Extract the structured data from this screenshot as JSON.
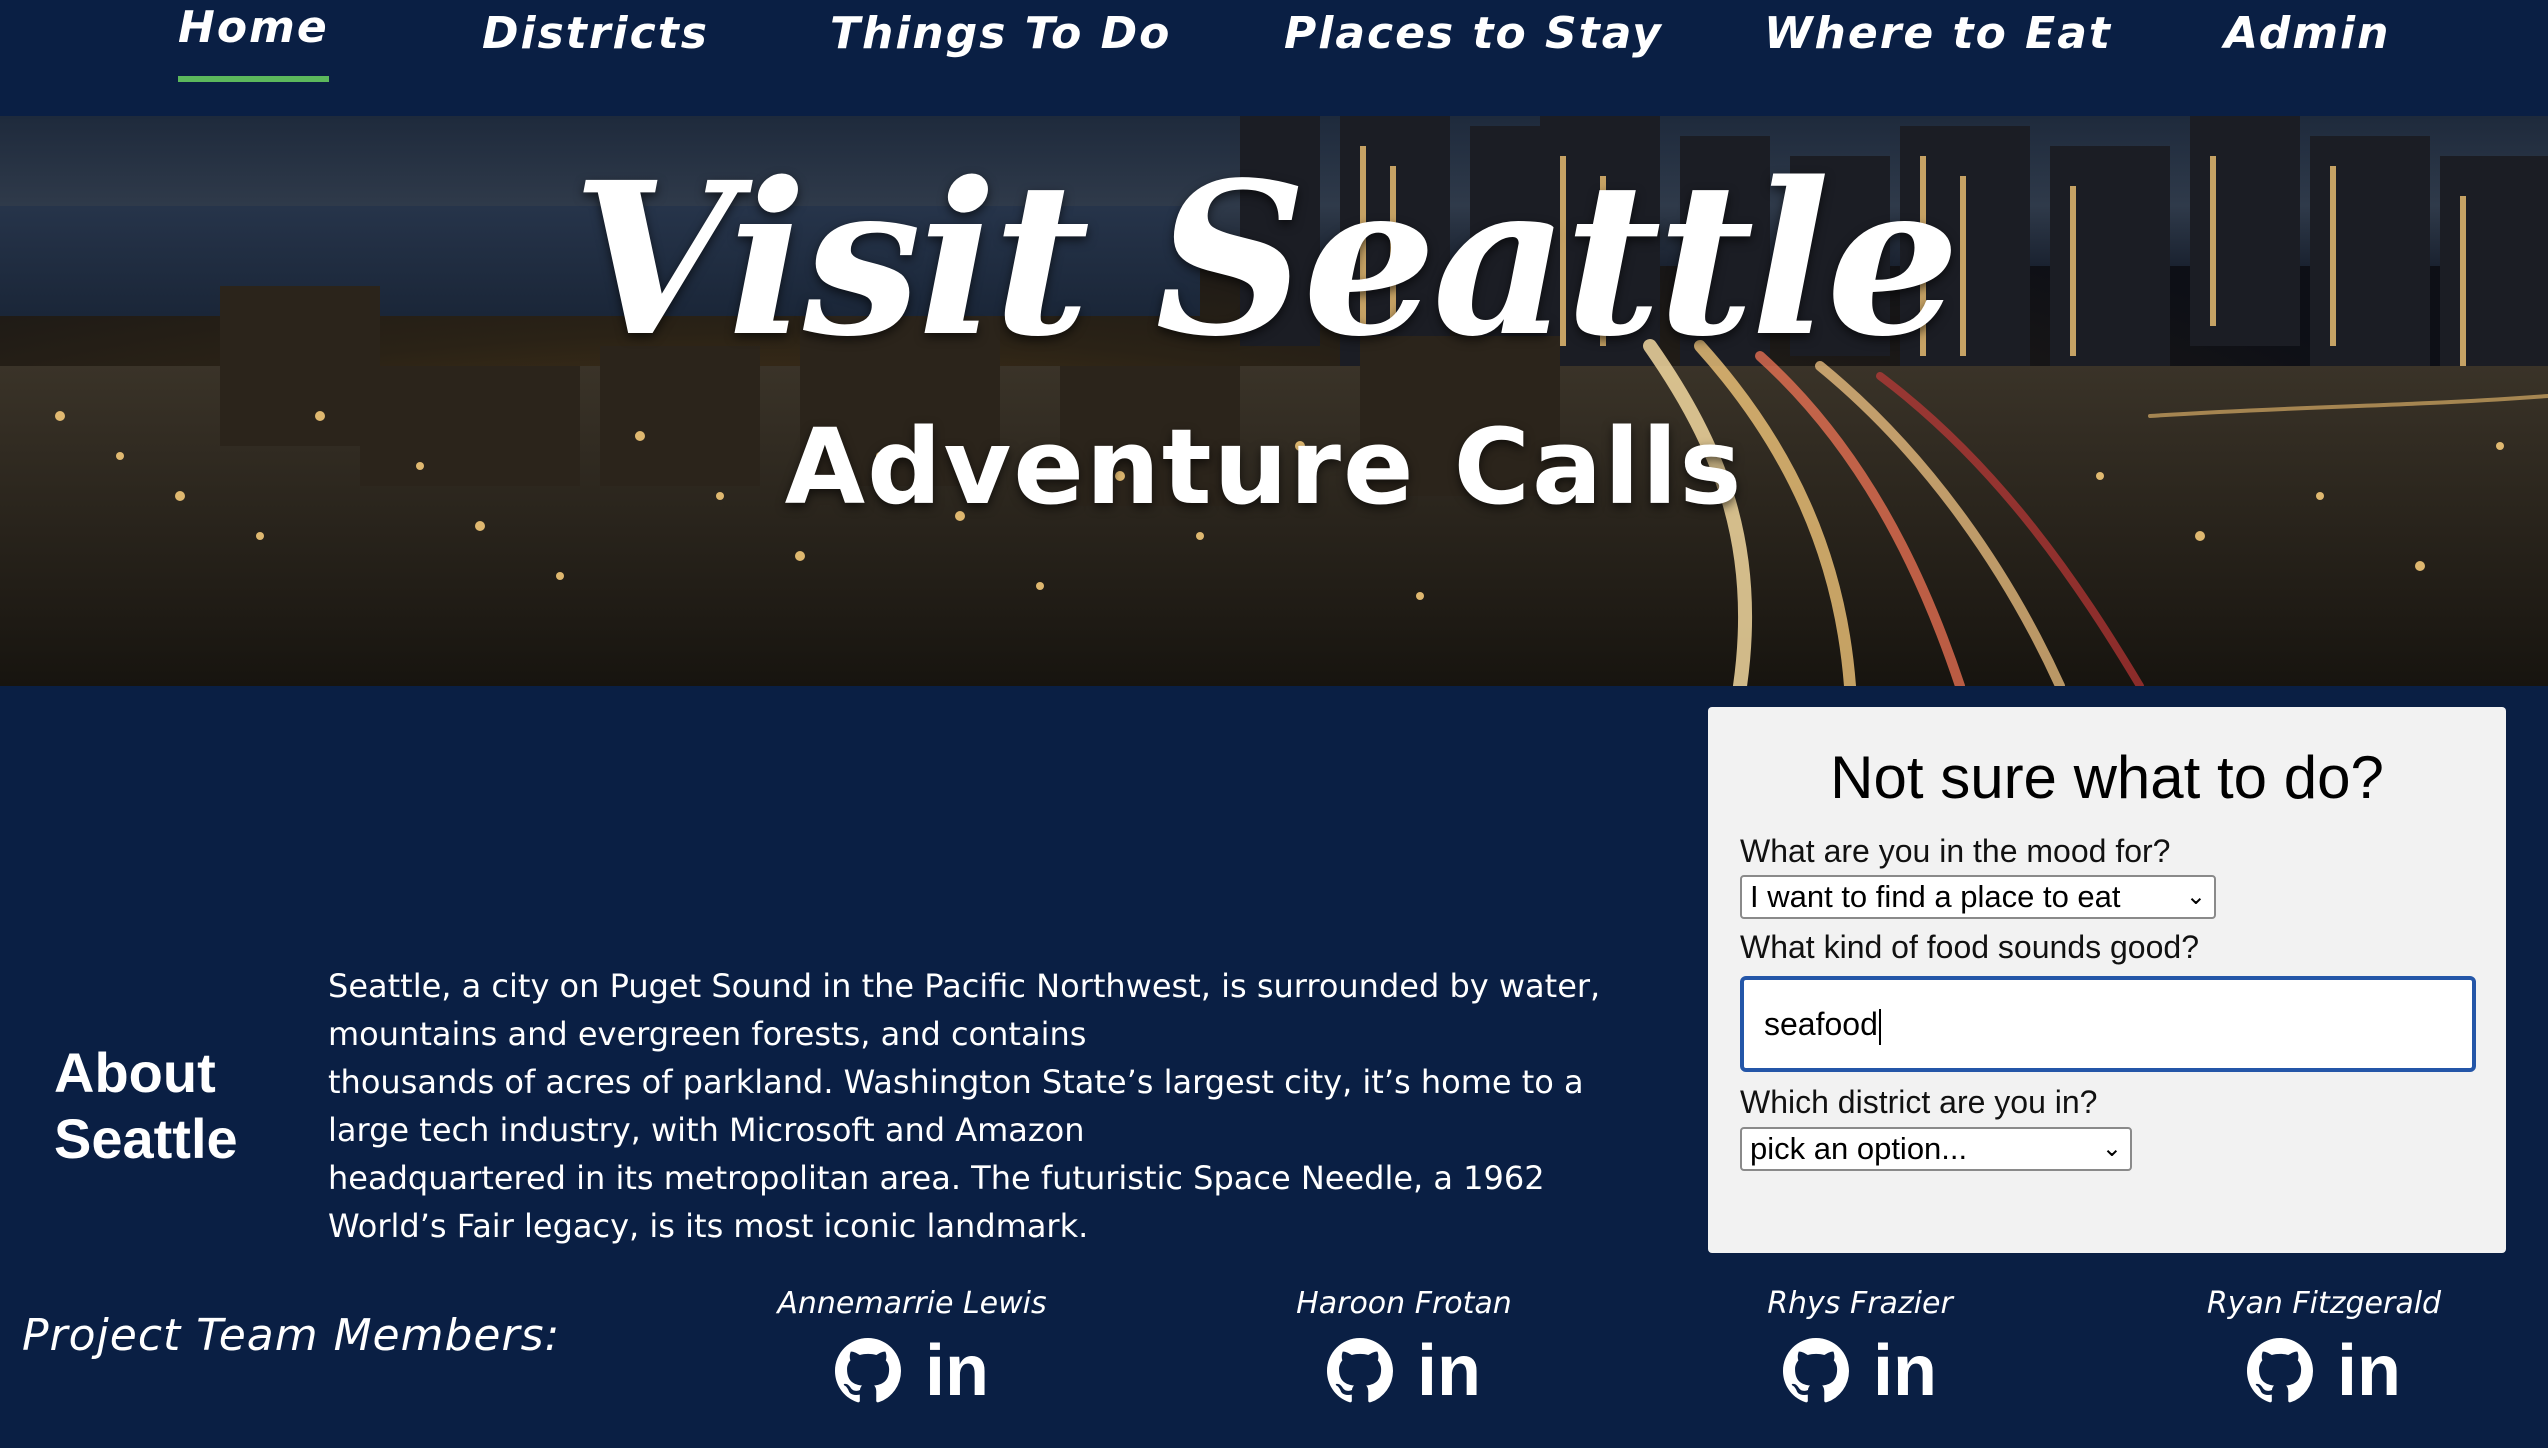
{
  "nav": {
    "items": [
      {
        "label": "Home",
        "active": true
      },
      {
        "label": "Districts"
      },
      {
        "label": "Things To Do"
      },
      {
        "label": "Places to Stay"
      },
      {
        "label": "Where to Eat"
      },
      {
        "label": "Admin"
      }
    ]
  },
  "hero": {
    "title": "Visit Seattle",
    "subtitle": "Adventure Calls"
  },
  "about": {
    "heading": "About Seattle",
    "paragraph_lines": [
      "Seattle, a city on Puget Sound in the Pacific Northwest, is surrounded by water, mountains and evergreen forests, and contains",
      "thousands of acres of parkland. Washington State’s largest city, it’s home to a large tech industry, with Microsoft and Amazon",
      "headquartered in its metropolitan area. The futuristic Space Needle, a 1962 World’s Fair legacy, is its most iconic landmark."
    ]
  },
  "form": {
    "title": "Not sure what to do?",
    "mood_label": "What are you in the mood for?",
    "mood_value": "I want to find a place to eat",
    "food_label": "What kind of food sounds good?",
    "food_value": "seafood",
    "district_label": "Which district are you in?",
    "district_value": "pick an option..."
  },
  "team": {
    "label": "Project Team Members:",
    "members": [
      {
        "name": "Annemarrie Lewis",
        "linkedin": "in"
      },
      {
        "name": "Haroon Frotan",
        "linkedin": "in"
      },
      {
        "name": "Rhys Frazier",
        "linkedin": "in"
      },
      {
        "name": "Ryan Fitzgerald",
        "linkedin": "in"
      }
    ]
  },
  "icons": [
    "github-icon",
    "linkedin-icon",
    "chevron-down-icon"
  ],
  "colors": {
    "background": "#0a1f44",
    "accent": "#5cb85c",
    "input_focus": "#2456a8",
    "card": "#f2f2f2"
  }
}
